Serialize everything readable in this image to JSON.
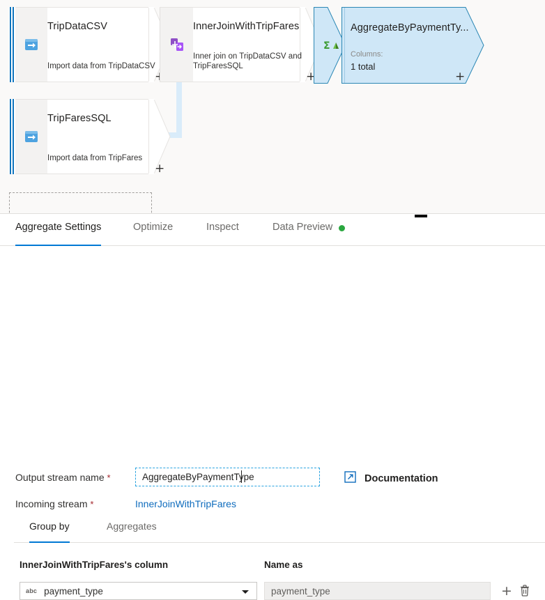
{
  "canvas": {
    "nodes": [
      {
        "id": "trip-data-csv",
        "type": "source",
        "title": "TripDataCSV",
        "subtitle": "Import data from TripDataCSV",
        "icon": "import-source-icon",
        "plus": "+"
      },
      {
        "id": "inner-join-with-trip-fares",
        "type": "join",
        "title": "InnerJoinWithTripFares",
        "subtitle": "Inner join on TripDataCSV and\nTripFaresSQL",
        "icon": "join-icon",
        "plus": "+"
      },
      {
        "id": "aggregate-by-payment-type",
        "type": "aggregate",
        "title": "AggregateByPaymentTy...",
        "columns_label": "Columns:",
        "columns_value": "1 total",
        "icon": "aggregate-sigma-icon",
        "plus": "+"
      },
      {
        "id": "trip-fares-sql",
        "type": "source",
        "title": "TripFaresSQL",
        "subtitle": "Import data from TripFares",
        "icon": "import-source-icon",
        "plus": "+"
      }
    ],
    "colors": {
      "source_stripe": "#0f74bd",
      "connector": "#d9ecfa",
      "selected_fill": "#cfe7f7",
      "selected_border": "#2b87b4",
      "canvas_bg": "#faf9f8"
    }
  },
  "panel": {
    "tabs": [
      {
        "label": "Aggregate Settings",
        "active": true
      },
      {
        "label": "Optimize",
        "active": false
      },
      {
        "label": "Inspect",
        "active": false
      },
      {
        "label": "Data Preview",
        "active": false,
        "status_dot": "#2aa73f"
      }
    ],
    "fields": {
      "output_stream_label": "Output stream name",
      "output_stream_required": "*",
      "output_stream_value": "AggregateByPaymentType",
      "incoming_stream_label": "Incoming stream",
      "incoming_stream_required": "*",
      "incoming_stream_value": "InnerJoinWithTripFares"
    },
    "documentation": {
      "label": "Documentation",
      "icon": "external-link-icon"
    },
    "subtabs": [
      {
        "label": "Group by",
        "active": true
      },
      {
        "label": "Aggregates",
        "active": false
      }
    ],
    "grid": {
      "columns": [
        {
          "header": "InnerJoinWithTripFares's column"
        },
        {
          "header": "Name as"
        }
      ],
      "rows": [
        {
          "column_type_badge": "abc",
          "column_value": "payment_type",
          "name_as_placeholder": "payment_type"
        }
      ],
      "add_label": "+",
      "delete_icon": "trash-icon"
    },
    "collapse_handle": "panel-collapse-handle"
  }
}
